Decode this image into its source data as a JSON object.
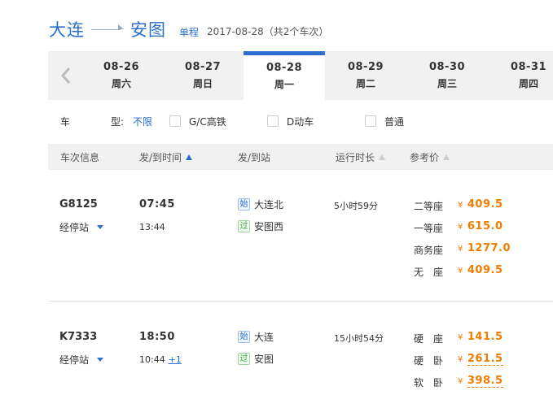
{
  "route": {
    "from": "大连",
    "to": "安图",
    "trip_type": "单程",
    "summary": "2017-08-28（共2个车次）"
  },
  "dates": {
    "prev_icon": "chevron-left-icon",
    "tabs": [
      {
        "date": "08-26",
        "weekday": "周六",
        "active": false
      },
      {
        "date": "08-27",
        "weekday": "周日",
        "active": false
      },
      {
        "date": "08-28",
        "weekday": "周一",
        "active": true
      },
      {
        "date": "08-29",
        "weekday": "周二",
        "active": false
      },
      {
        "date": "08-30",
        "weekday": "周三",
        "active": false
      },
      {
        "date": "08-31",
        "weekday": "周四",
        "active": false
      }
    ]
  },
  "filter": {
    "label_a": "车",
    "label_b": "型:",
    "all": "不限",
    "options": [
      "G/C高铁",
      "D动车",
      "普通"
    ]
  },
  "columns": {
    "train_info": "车次信息",
    "time": "发/到时间",
    "station": "发/到站",
    "duration": "运行时长",
    "price": "参考价"
  },
  "trains": [
    {
      "no": "G8125",
      "stops_label": "经停站",
      "dep_time": "07:45",
      "arr_time": "13:44",
      "plus_day": "",
      "dep_tag": "始",
      "dep_station": "大连北",
      "arr_tag": "过",
      "arr_station": "安图西",
      "duration": "5小时59分",
      "seats": [
        {
          "name": "二等座",
          "price": "409.5"
        },
        {
          "name": "一等座",
          "price": "615.0"
        },
        {
          "name": "商务座",
          "price": "1277.0"
        },
        {
          "name": "无　座",
          "price": "409.5"
        }
      ]
    },
    {
      "no": "K7333",
      "stops_label": "经停站",
      "dep_time": "18:50",
      "arr_time": "10:44",
      "plus_day": "+1",
      "dep_tag": "始",
      "dep_station": "大连",
      "arr_tag": "过",
      "arr_station": "安图",
      "duration": "15小时54分",
      "seats": [
        {
          "name": "硬　座",
          "price": "141.5"
        },
        {
          "name": "硬　卧",
          "price": "261.5"
        },
        {
          "name": "软　卧",
          "price": "398.5"
        }
      ]
    }
  ],
  "currency": "¥",
  "colors": {
    "accent": "#2a6fcb",
    "price": "#f07c00",
    "bar_bg": "#f1f1f1"
  }
}
